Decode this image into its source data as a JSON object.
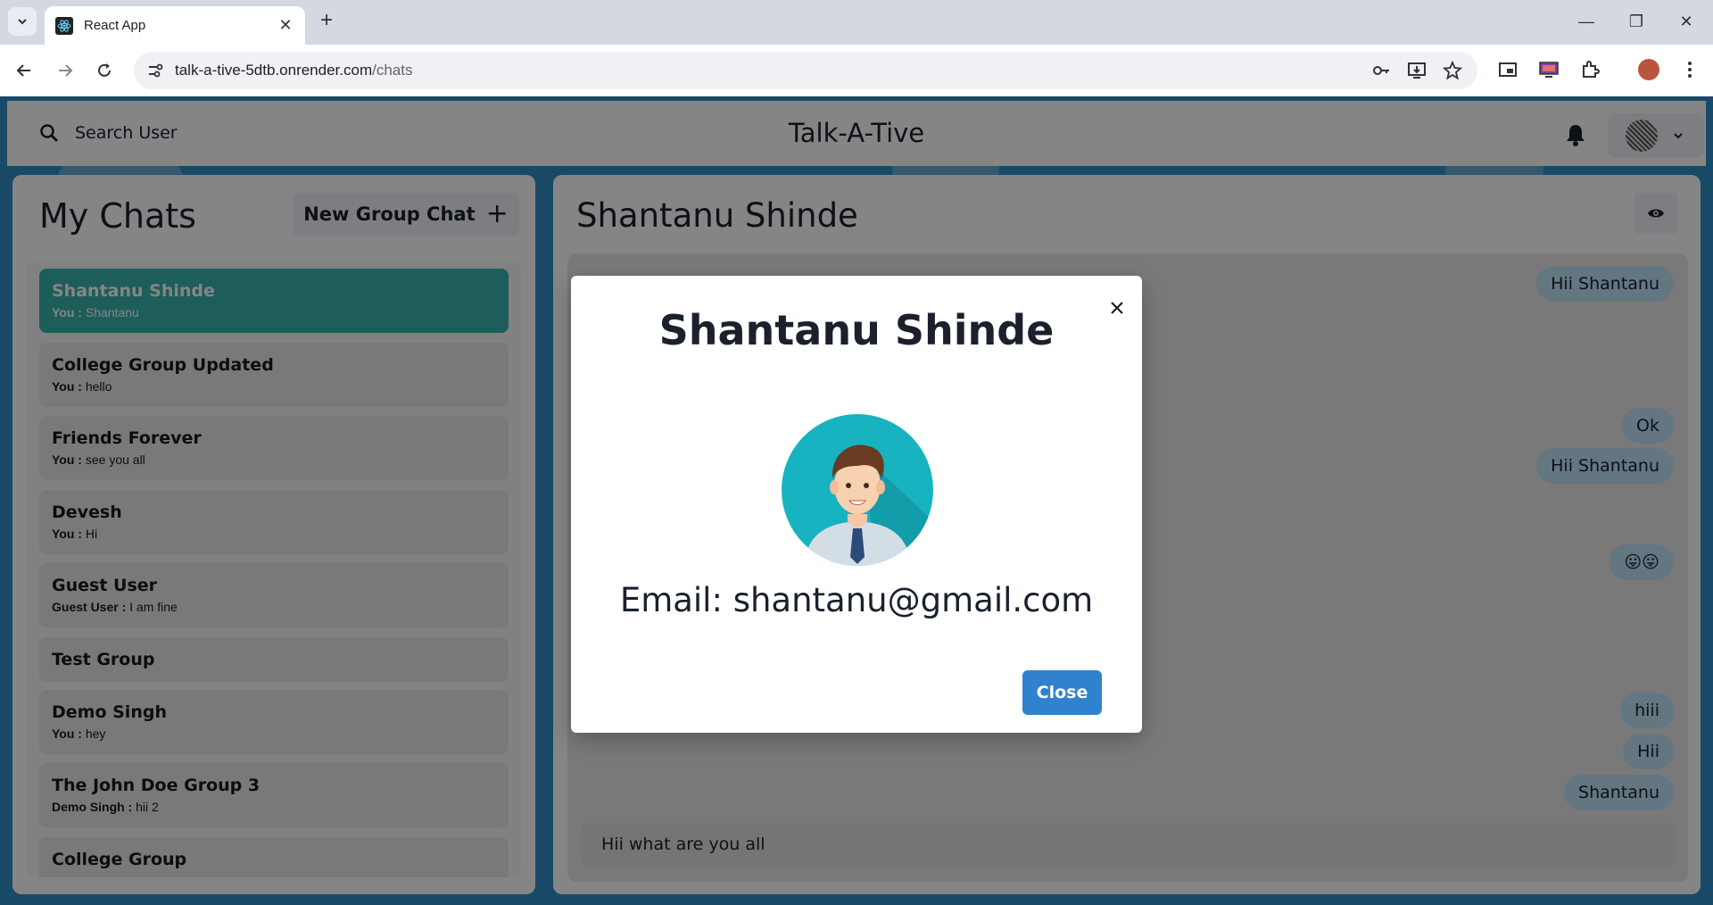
{
  "browser": {
    "tab_title": "React App",
    "url_host": "talk-a-tive-5dtb.onrender.com",
    "url_path": "/chats"
  },
  "app": {
    "search_label": "Search User",
    "title": "Talk-A-Tive"
  },
  "chats_panel": {
    "title": "My Chats",
    "new_group_label": "New Group Chat",
    "items": [
      {
        "name": "Shantanu Shinde",
        "sender": "You :",
        "text": "Shantanu",
        "active": true
      },
      {
        "name": "College Group Updated",
        "sender": "You :",
        "text": "hello"
      },
      {
        "name": "Friends Forever",
        "sender": "You :",
        "text": "see you all"
      },
      {
        "name": "Devesh",
        "sender": "You :",
        "text": "Hi"
      },
      {
        "name": "Guest User",
        "sender": "Guest User :",
        "text": "I am fine"
      },
      {
        "name": "Test Group",
        "sender": "",
        "text": ""
      },
      {
        "name": "Demo Singh",
        "sender": "You :",
        "text": "hey"
      },
      {
        "name": "The John Doe Group 3",
        "sender": "Demo Singh :",
        "text": "hii 2"
      },
      {
        "name": "College Group",
        "sender": "",
        "text": ""
      }
    ]
  },
  "conversation": {
    "title": "Shantanu Shinde",
    "messages": [
      "Hii Shantanu",
      "Ok",
      "Hii Shantanu",
      "😛😛",
      "hiii",
      "Hii",
      "Shantanu"
    ],
    "input_value": "Hii what are you all"
  },
  "modal": {
    "title": "Shantanu Shinde",
    "email": "Email: shantanu@gmail.com",
    "close_label": "Close"
  },
  "colors": {
    "active_chat": "#38b2ac",
    "message_bubble": "#bee3f8",
    "primary_button": "#3182ce",
    "page_background": "#2f8ec7"
  }
}
